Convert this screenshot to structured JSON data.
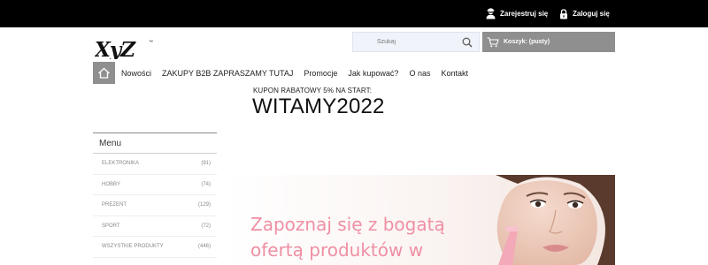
{
  "topbar": {
    "register_label": "Zarejestruj się",
    "login_label": "Zaloguj się"
  },
  "logo": {
    "text": "XyZ",
    "tm": "™"
  },
  "search": {
    "placeholder": "Szukaj"
  },
  "cart": {
    "label": "Koszyk: (pusty)"
  },
  "nav": {
    "items": [
      {
        "label": "Nowości"
      },
      {
        "label": "ZAKUPY B2B ZAPRASZAMY TUTAJ"
      },
      {
        "label": "Promocje"
      },
      {
        "label": "Jak kupować?"
      },
      {
        "label": "O nas"
      },
      {
        "label": "Kontakt"
      }
    ]
  },
  "coupon": {
    "label": "KUPON RABATOWY 5% NA START:",
    "code": "WITAMY2022"
  },
  "sidebar": {
    "title": "Menu",
    "items": [
      {
        "label": "ELEKTRONIKA",
        "count": "(91)"
      },
      {
        "label": "HOBBY",
        "count": "(74)"
      },
      {
        "label": "PREZENT",
        "count": "(129)"
      },
      {
        "label": "SPORT",
        "count": "(72)"
      },
      {
        "label": "WSZYSTKIE PRODUKTY",
        "count": "(446)"
      }
    ]
  },
  "banner": {
    "line1": "Zapoznaj się z bogatą",
    "line2": "ofertą produktów w"
  },
  "colors": {
    "topbar": "#000000",
    "accent_gray": "#8f8f8f",
    "banner_text": "#ef8fa3"
  },
  "icons": {
    "register": "user-icon",
    "login": "lock-icon",
    "search": "search-icon",
    "cart": "cart-icon",
    "home": "home-icon"
  }
}
